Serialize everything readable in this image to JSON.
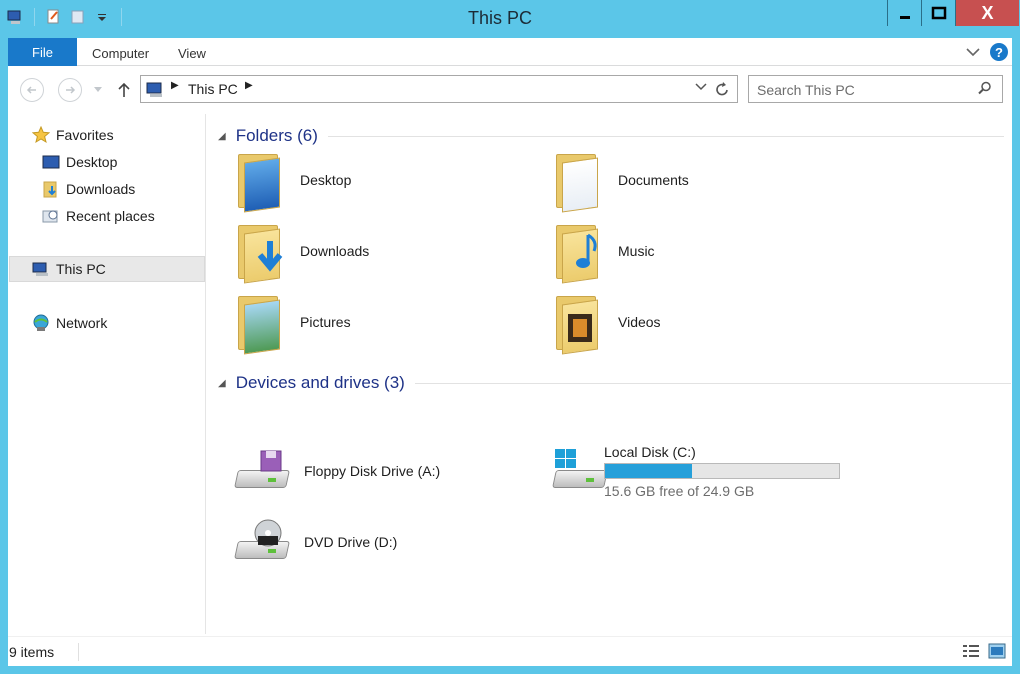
{
  "window": {
    "title": "This PC",
    "close_label": "X"
  },
  "ribbon": {
    "file_tab": "File",
    "tabs": [
      "Computer",
      "View"
    ],
    "help_label": "?"
  },
  "address": {
    "crumbs": [
      "This PC"
    ],
    "search_placeholder": "Search This PC"
  },
  "nav": {
    "favorites": "Favorites",
    "favorites_items": [
      "Desktop",
      "Downloads",
      "Recent places"
    ],
    "this_pc": "This PC",
    "network": "Network"
  },
  "content": {
    "folders_header": "Folders (6)",
    "folders": [
      "Desktop",
      "Documents",
      "Downloads",
      "Music",
      "Pictures",
      "Videos"
    ],
    "devices_header": "Devices and drives (3)",
    "devices": {
      "floppy": "Floppy Disk Drive (A:)",
      "dvd": "DVD Drive (D:)",
      "local_disk": {
        "label": "Local Disk (C:)",
        "free_text": "15.6 GB free of 24.9 GB",
        "used_fraction": 0.373
      }
    }
  },
  "status": {
    "item_count": "9 items"
  },
  "colors": {
    "titlebar": "#5bc6e8",
    "accent": "#1979ca",
    "close": "#c75050",
    "group_header": "#1e3287",
    "disk_bar": "#26a0da"
  }
}
